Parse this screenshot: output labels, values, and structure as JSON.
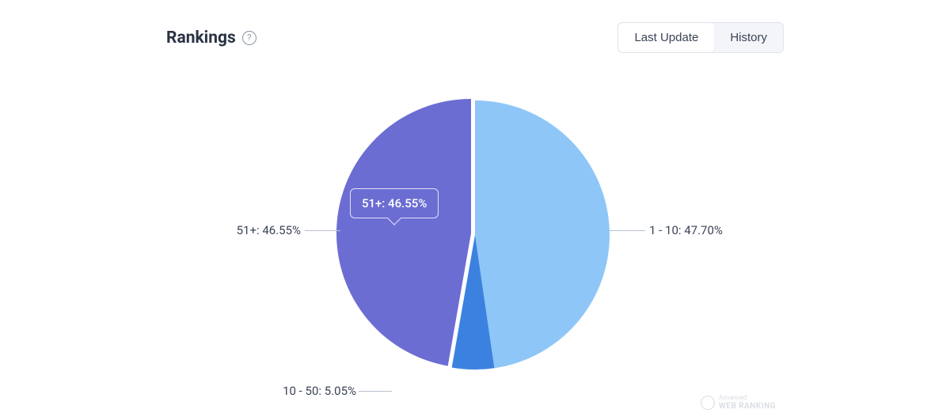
{
  "header": {
    "title": "Rankings",
    "help_tooltip": "?"
  },
  "toggle": {
    "last_update": "Last Update",
    "history": "History",
    "active": "last_update"
  },
  "chart_data": {
    "type": "pie",
    "title": "Rankings",
    "series": [
      {
        "name": "1 - 10",
        "value": 47.7,
        "color": "#8ec6f7"
      },
      {
        "name": "10 - 50",
        "value": 5.05,
        "color": "#3b82e0"
      },
      {
        "name": "51+",
        "value": 46.55,
        "color": "#6c6dd3"
      }
    ],
    "labels": {
      "right": "1 - 10: 47.70%",
      "bottom_left": "10 - 50: 5.05%",
      "left": "51+: 46.55%"
    },
    "tooltip_text": "51+: 46.55%"
  },
  "watermark": {
    "line1": "Advanced",
    "line2": "WEB RANKING"
  }
}
